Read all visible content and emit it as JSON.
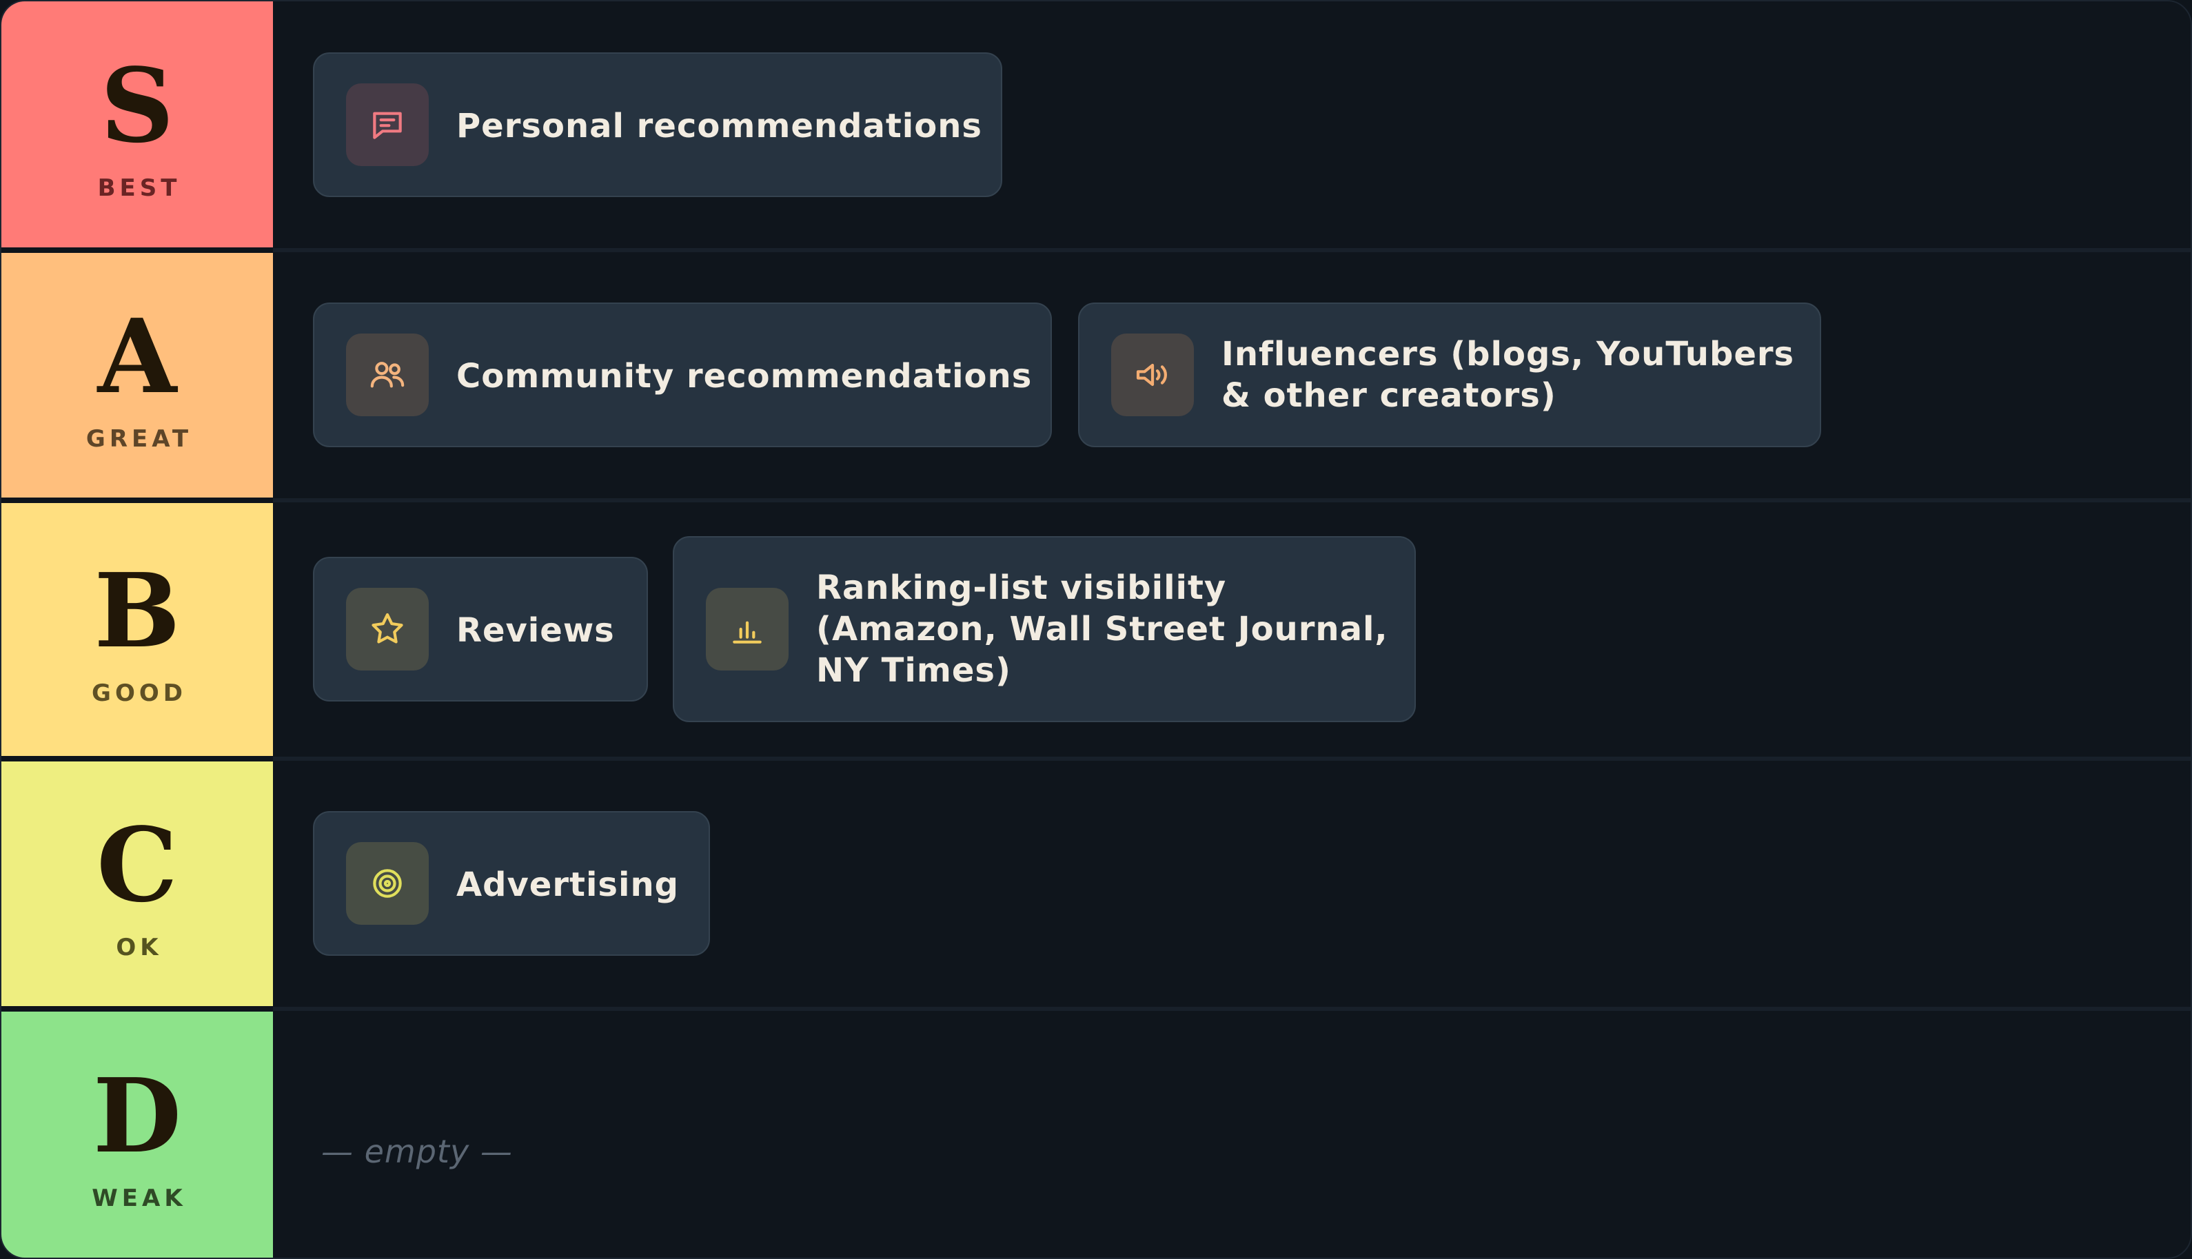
{
  "tiers": [
    {
      "letter": "S",
      "label": "BEST",
      "color": "#ff7b77",
      "label_color": "#6b2424",
      "items": [
        {
          "text": "Personal recommendations",
          "icon": "chat-bubble-icon",
          "icon_color": "#f07a82"
        }
      ]
    },
    {
      "letter": "A",
      "label": "GREAT",
      "color": "#ffbf7d",
      "label_color": "#5e4528",
      "items": [
        {
          "text": "Community recommendations",
          "icon": "users-icon",
          "icon_color": "#f4b47e"
        },
        {
          "text": "Influencers (blogs, YouTubers\n& other creators)",
          "icon": "megaphone-icon",
          "icon_color": "#f4ad72"
        }
      ]
    },
    {
      "letter": "B",
      "label": "GOOD",
      "color": "#ffdf80",
      "label_color": "#5f5024",
      "items": [
        {
          "text": "Reviews",
          "icon": "star-icon",
          "icon_color": "#f2cc5c"
        },
        {
          "text": "Ranking-list visibility\n(Amazon, Wall Street Journal,\nNY Times)",
          "icon": "bar-chart-icon",
          "icon_color": "#f2cc5c"
        }
      ]
    },
    {
      "letter": "C",
      "label": "OK",
      "color": "#eeee80",
      "label_color": "#55531f",
      "items": [
        {
          "text": "Advertising",
          "icon": "target-icon",
          "icon_color": "#e0df5c"
        }
      ]
    },
    {
      "letter": "D",
      "label": "WEAK",
      "color": "#8de38a",
      "label_color": "#2f4a26",
      "items": [],
      "empty_text": "— empty —"
    }
  ]
}
